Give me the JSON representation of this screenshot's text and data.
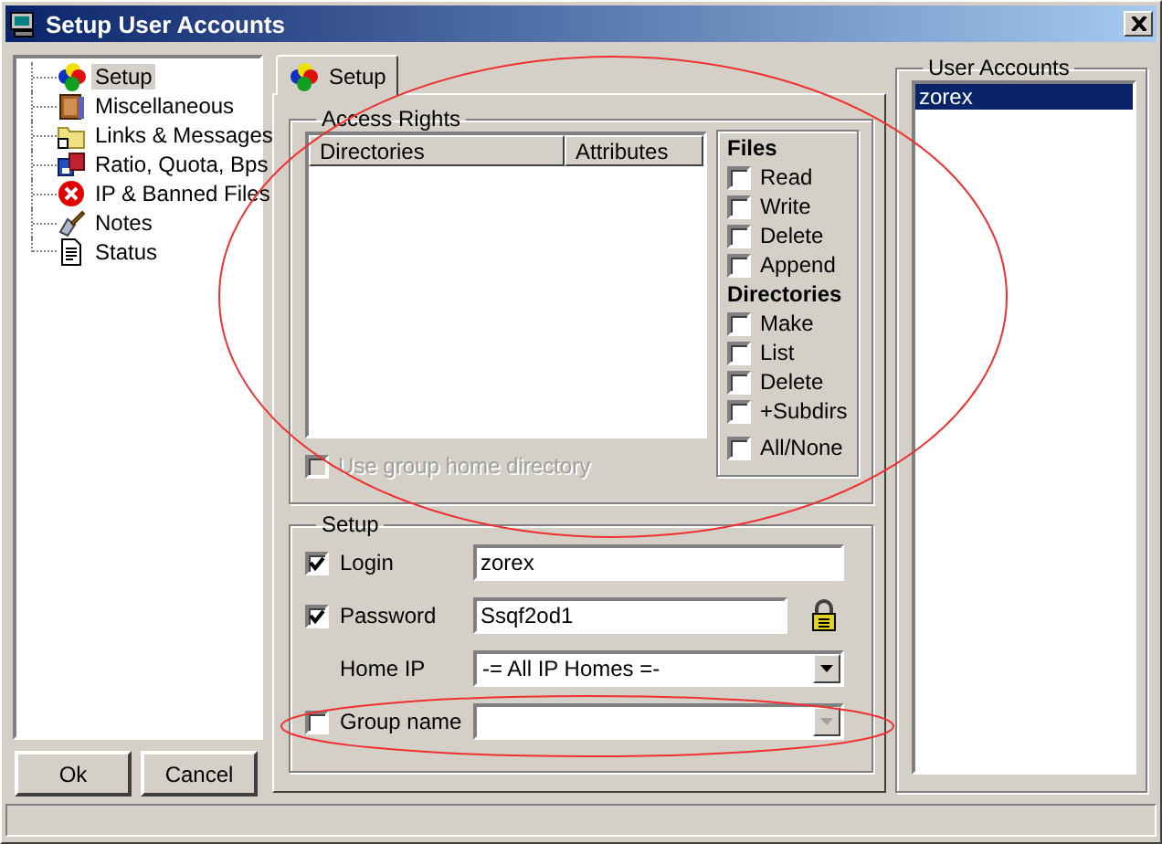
{
  "window": {
    "title": "Setup User Accounts"
  },
  "sidebar": {
    "items": [
      {
        "label": "Setup",
        "selected": true
      },
      {
        "label": "Miscellaneous",
        "selected": false
      },
      {
        "label": "Links & Messages",
        "selected": false
      },
      {
        "label": "Ratio, Quota, Bps",
        "selected": false
      },
      {
        "label": "IP & Banned Files",
        "selected": false
      },
      {
        "label": "Notes",
        "selected": false
      },
      {
        "label": "Status",
        "selected": false
      }
    ]
  },
  "buttons": [
    {
      "label": "Ok"
    },
    {
      "label": "Cancel"
    }
  ],
  "tabs": [
    {
      "label": "Setup",
      "selected": true
    }
  ],
  "access_rights": {
    "title": "Access Rights",
    "columns": [
      "Directories",
      "Attributes"
    ],
    "use_group_home": {
      "label": "Use group home directory",
      "checked": false,
      "disabled": true
    },
    "files": {
      "title": "Files",
      "options": [
        {
          "label": "Read",
          "checked": false
        },
        {
          "label": "Write",
          "checked": false
        },
        {
          "label": "Delete",
          "checked": false
        },
        {
          "label": "Append",
          "checked": false
        }
      ]
    },
    "directories": {
      "title": "Directories",
      "options": [
        {
          "label": "Make",
          "checked": false
        },
        {
          "label": "List",
          "checked": false
        },
        {
          "label": "Delete",
          "checked": false
        },
        {
          "label": "+Subdirs",
          "checked": false
        }
      ]
    },
    "all_none": {
      "label": "All/None",
      "checked": false
    }
  },
  "setup": {
    "title": "Setup",
    "fields": [
      {
        "kind": "text",
        "label": "Login",
        "checked": true,
        "value": "zorex"
      },
      {
        "kind": "secret",
        "label": "Password",
        "checked": true,
        "value": "Ssqf2od1"
      },
      {
        "kind": "combo",
        "label": "Home IP",
        "value": "-= All IP Homes =-",
        "disabled": false
      },
      {
        "kind": "combo",
        "label": "Group name",
        "checked": false,
        "disabled": true
      }
    ]
  },
  "user_accounts": {
    "title": "User Accounts",
    "items": [
      {
        "label": "zorex",
        "selected": true
      }
    ]
  },
  "annotations": [
    {
      "kind": "ellipse"
    },
    {
      "kind": "ellipse"
    }
  ]
}
